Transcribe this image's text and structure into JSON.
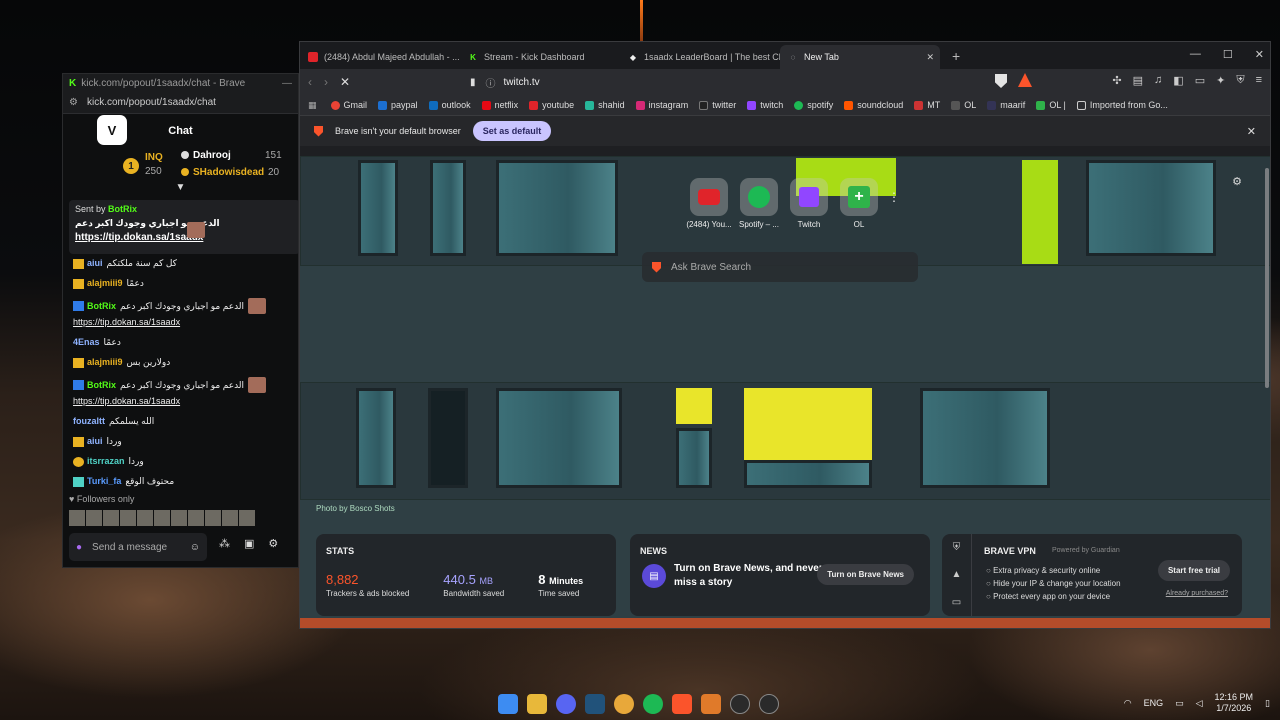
{
  "chat_window": {
    "title": "kick.com/popout/1saadx/chat - Brave",
    "url": "kick.com/popout/1saadx/chat",
    "header": "Chat",
    "leaderboard": {
      "rank": "1",
      "top_user": "INQ",
      "top_value": "250",
      "user2": "Dahrooj",
      "value2": "151",
      "user3": "SHadowisdead",
      "value3": "20"
    },
    "pinned": {
      "sent_by": "Sent by",
      "bot": "BotRix",
      "text": "الدعم مو اجباري وجودك اكبر دعم",
      "link": "https://tip.dokan.sa/1saadx"
    },
    "messages": [
      {
        "user": "aiui",
        "text": "كل كم سنة ملكتكم",
        "color": "#8fb3ff"
      },
      {
        "user": "alajmiii9",
        "text": "دعمًا",
        "color": "#e9b222"
      },
      {
        "user": "BotRix",
        "text": "الدعم مو اجباري وجودك اكبر دعم",
        "color": "#53fc18",
        "link": "https://tip.dokan.sa/1saadx"
      },
      {
        "user": "4Enas",
        "text": "دعمًا",
        "color": "#8fb3ff"
      },
      {
        "user": "alajmiii9",
        "text": "دولارين بس",
        "color": "#e9b222"
      },
      {
        "user": "BotRix",
        "text": "الدعم مو اجباري وجودك اكبر دعم",
        "color": "#53fc18",
        "link": "https://tip.dokan.sa/1saadx"
      },
      {
        "user": "fouzaltt",
        "text": "الله يسلمكم",
        "color": "#8fb3ff"
      },
      {
        "user": "aiui",
        "text": "وردا",
        "color": "#8fb3ff"
      },
      {
        "user": "itsrrazan",
        "text": "وردا",
        "color": "#4fd1c5"
      },
      {
        "user": "Turki_fa",
        "text": "محتوف الوقع",
        "color": "#5a9cff"
      }
    ],
    "followers_only": "Followers only",
    "send_placeholder": "Send a message"
  },
  "browser": {
    "tabs": [
      {
        "label": "(2484) Abdul Majeed Abdullah - ...",
        "icon": "youtube-icon"
      },
      {
        "label": "Stream - Kick Dashboard",
        "icon": "kick-icon"
      },
      {
        "label": "1saadx LeaderBoard | The best Chatt...",
        "icon": "leaderboard-icon"
      },
      {
        "label": "New Tab",
        "icon": "loading-icon"
      }
    ],
    "url": "twitch.tv",
    "bookmarks": [
      "Gmail",
      "paypal",
      "outlook",
      "netflix",
      "youtube",
      "shahid",
      "instagram",
      "twitter",
      "twitch",
      "spotify",
      "soundcloud",
      "MT",
      "OL",
      "maarif",
      "OL |",
      "Imported from Go..."
    ],
    "infobar": {
      "text": "Brave isn't your default browser",
      "button": "Set as default"
    },
    "top_sites": [
      {
        "label": "(2484) You...",
        "color": "#e0242a"
      },
      {
        "label": "Spotify – ...",
        "color": "#1db954"
      },
      {
        "label": "Twitch",
        "color": "#9146ff"
      },
      {
        "label": "OL",
        "color": "#2fb34a"
      }
    ],
    "search_placeholder": "Ask Brave Search",
    "photo_credit": "Photo by Bosco Shots",
    "stats": {
      "title": "STATS",
      "trackers": "8,882",
      "trackers_label": "Trackers & ads blocked",
      "bandwidth": "440.5",
      "bandwidth_unit": "MB",
      "bandwidth_label": "Bandwidth saved",
      "time": "8",
      "time_unit": "Minutes",
      "time_label": "Time saved"
    },
    "news": {
      "title": "NEWS",
      "text": "Turn on Brave News, and never miss a story",
      "button": "Turn on Brave News"
    },
    "vpn": {
      "title": "BRAVE VPN",
      "powered": "Powered by Guardian",
      "features": [
        "Extra privacy & security online",
        "Hide your IP & change your location",
        "Protect every app on your device"
      ],
      "button": "Start free trial",
      "already": "Already purchased?"
    }
  },
  "taskbar": {
    "lang": "ENG",
    "time": "12:16 PM",
    "date": "1/7/2026"
  }
}
